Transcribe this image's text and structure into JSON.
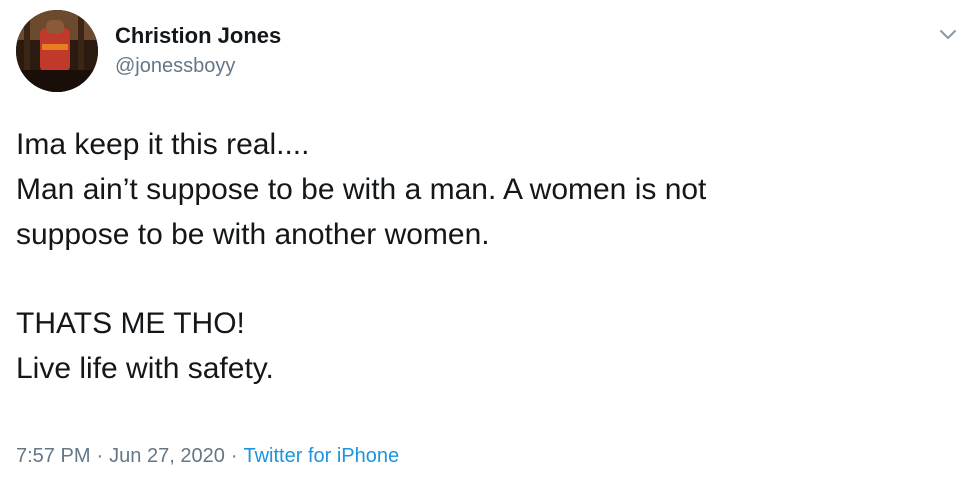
{
  "author": {
    "display_name": "Christion Jones",
    "handle": "@jonessboyy",
    "avatar_icon": "profile-photo"
  },
  "tweet": {
    "lines_top": [
      "Ima keep it this real....",
      "Man ain’t suppose to be with a man. A women is not",
      "suppose to be with another women."
    ],
    "lines_bottom": [
      "THATS ME THO!",
      "Live life with safety."
    ]
  },
  "meta": {
    "time": "7:57 PM",
    "separator": "·",
    "date": "Jun 27, 2020",
    "source": "Twitter for iPhone"
  },
  "colors": {
    "text": "#14171a",
    "secondary": "#657786",
    "link": "#1b95e0"
  },
  "menu": {
    "caret_icon": "chevron-down-icon"
  }
}
